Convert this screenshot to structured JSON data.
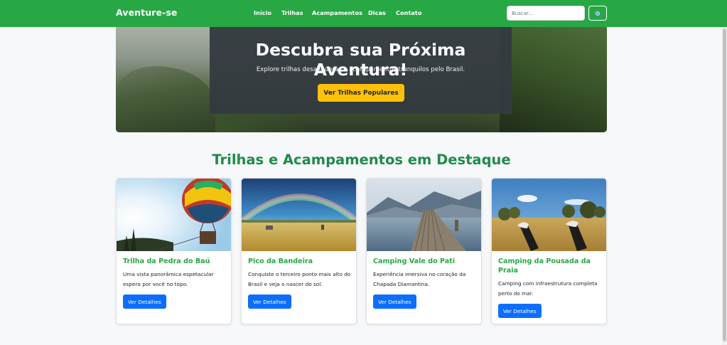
{
  "navbar": {
    "brand": "Aventure-se",
    "links": [
      "Início",
      "Trilhas",
      "Acampamentos",
      "Dicas",
      "Contato"
    ],
    "search_placeholder": "Buscar...",
    "search_button_icon": "search-icon"
  },
  "hero": {
    "title": "Descubra sua Próxima Aventura!",
    "subtitle": "Explore trilhas desafiadoras e acampamentos tranquilos pelo Brasil.",
    "button_label": "Ver Trilhas Populares"
  },
  "featured": {
    "title": "Trilhas e Acampamentos em Destaque",
    "cards": [
      {
        "title": "Trilha da Pedra do Baú",
        "text": "Uma vista panorâmica espetacular espera por você no topo.",
        "button": "Ver Detalhes",
        "image": "hot-air-balloon"
      },
      {
        "title": "Pico da Bandeira",
        "text": "Conquiste o terceiro ponto mais alto do Brasil e veja o nascer do sol.",
        "button": "Ver Detalhes",
        "image": "rainbow-field"
      },
      {
        "title": "Camping Vale do Pati",
        "text": "Experiência imersiva no coração da Chapada Diamantina.",
        "button": "Ver Detalhes",
        "image": "lake-pier"
      },
      {
        "title": "Camping da Pousada da Praia",
        "text": "Camping com infraestrutura completa perto do mar.",
        "button": "Ver Detalhes",
        "image": "feet-in-field"
      }
    ]
  },
  "colors": {
    "navbar": "#28a745",
    "heading": "#1e8b4a",
    "primary_button": "#0d6efd",
    "hero_button": "#ffc107"
  }
}
